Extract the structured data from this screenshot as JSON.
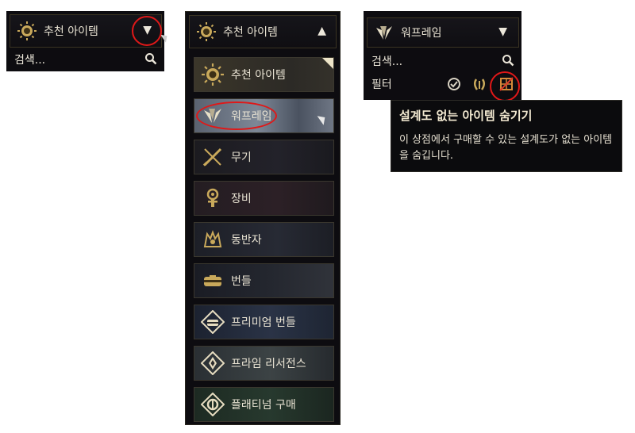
{
  "left_panel": {
    "title": "추천 아이템",
    "caret": "▼",
    "search_placeholder": "검색...",
    "icon": "sun-icon"
  },
  "middle_panel": {
    "title": "추천 아이템",
    "caret": "▲",
    "categories": [
      {
        "label": "추천 아이템",
        "icon": "sun-icon"
      },
      {
        "label": "워프레임",
        "icon": "warframe-icon"
      },
      {
        "label": "무기",
        "icon": "weapons-icon"
      },
      {
        "label": "장비",
        "icon": "gear-icon"
      },
      {
        "label": "동반자",
        "icon": "companion-icon"
      },
      {
        "label": "번들",
        "icon": "bundle-icon"
      },
      {
        "label": "프리미엄 번들",
        "icon": "premium-bundle-icon"
      },
      {
        "label": "프라임 리서전스",
        "icon": "prime-resurgence-icon"
      },
      {
        "label": "플래티넘 구매",
        "icon": "platinum-icon"
      }
    ]
  },
  "right_panel": {
    "title": "워프레임",
    "caret": "▼",
    "search_placeholder": "검색...",
    "filter_label": "필터",
    "filter_icons": [
      "check-circle-icon",
      "wreath-icon",
      "blueprint-hidden-icon"
    ]
  },
  "tooltip": {
    "title": "설계도 없는 아이템 숨기기",
    "body": "이 상점에서 구매할 수 있는 설계도가 없는 아이템을 숨깁니다."
  },
  "colors": {
    "accent_gold": "#d4b66a",
    "highlight_red": "#e01818",
    "panel_bg": "#0d0c10"
  }
}
